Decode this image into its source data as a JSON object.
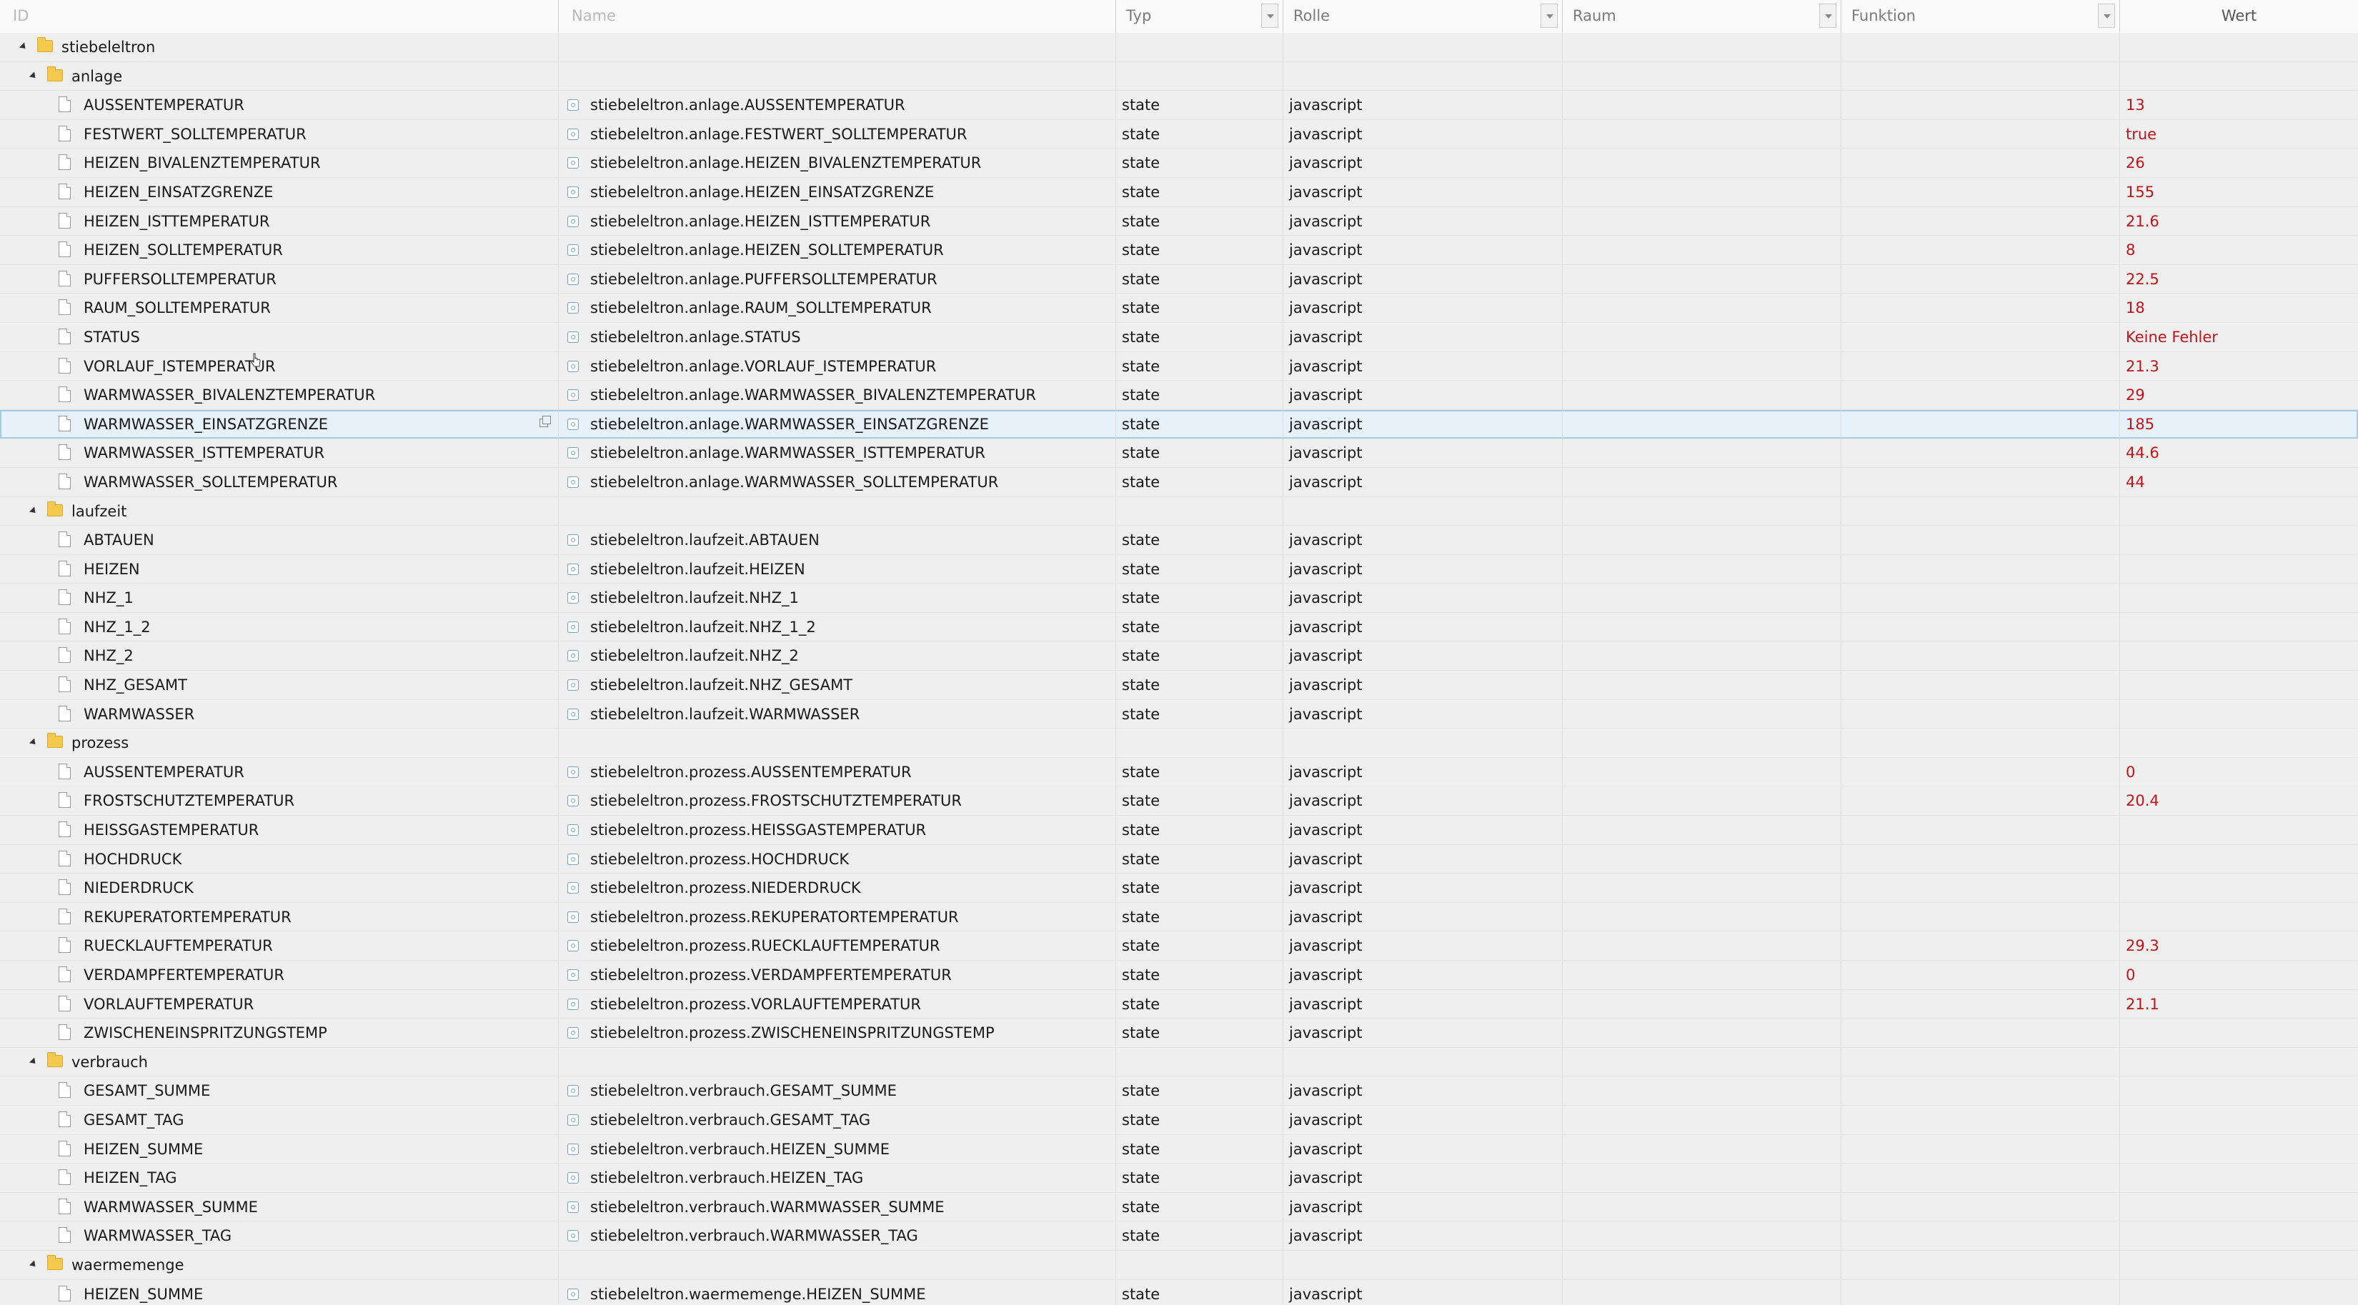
{
  "columns": {
    "id": "ID",
    "name": "Name",
    "typ": "Typ",
    "rolle": "Rolle",
    "raum": "Raum",
    "funktion": "Funktion",
    "wert": "Wert"
  },
  "rows": [
    {
      "kind": "folder",
      "level": 0,
      "label": "stiebeleltron"
    },
    {
      "kind": "folder",
      "level": 1,
      "label": "anlage"
    },
    {
      "kind": "state",
      "label": "AUSSENTEMPERATUR",
      "name": "stiebeleltron.anlage.AUSSENTEMPERATUR",
      "typ": "state",
      "rolle": "javascript",
      "wert": "13"
    },
    {
      "kind": "state",
      "label": "FESTWERT_SOLLTEMPERATUR",
      "name": "stiebeleltron.anlage.FESTWERT_SOLLTEMPERATUR",
      "typ": "state",
      "rolle": "javascript",
      "wert": "true"
    },
    {
      "kind": "state",
      "label": "HEIZEN_BIVALENZTEMPERATUR",
      "name": "stiebeleltron.anlage.HEIZEN_BIVALENZTEMPERATUR",
      "typ": "state",
      "rolle": "javascript",
      "wert": "26"
    },
    {
      "kind": "state",
      "label": "HEIZEN_EINSATZGRENZE",
      "name": "stiebeleltron.anlage.HEIZEN_EINSATZGRENZE",
      "typ": "state",
      "rolle": "javascript",
      "wert": "155"
    },
    {
      "kind": "state",
      "label": "HEIZEN_ISTTEMPERATUR",
      "name": "stiebeleltron.anlage.HEIZEN_ISTTEMPERATUR",
      "typ": "state",
      "rolle": "javascript",
      "wert": "21.6"
    },
    {
      "kind": "state",
      "label": "HEIZEN_SOLLTEMPERATUR",
      "name": "stiebeleltron.anlage.HEIZEN_SOLLTEMPERATUR",
      "typ": "state",
      "rolle": "javascript",
      "wert": "8"
    },
    {
      "kind": "state",
      "label": "PUFFERSOLLTEMPERATUR",
      "name": "stiebeleltron.anlage.PUFFERSOLLTEMPERATUR",
      "typ": "state",
      "rolle": "javascript",
      "wert": "22.5"
    },
    {
      "kind": "state",
      "label": "RAUM_SOLLTEMPERATUR",
      "name": "stiebeleltron.anlage.RAUM_SOLLTEMPERATUR",
      "typ": "state",
      "rolle": "javascript",
      "wert": "18"
    },
    {
      "kind": "state",
      "label": "STATUS",
      "name": "stiebeleltron.anlage.STATUS",
      "typ": "state",
      "rolle": "javascript",
      "wert": "Keine Fehler"
    },
    {
      "kind": "state",
      "label": "VORLAUF_ISTEMPERATUR",
      "name": "stiebeleltron.anlage.VORLAUF_ISTEMPERATUR",
      "typ": "state",
      "rolle": "javascript",
      "wert": "21.3"
    },
    {
      "kind": "state",
      "label": "WARMWASSER_BIVALENZTEMPERATUR",
      "name": "stiebeleltron.anlage.WARMWASSER_BIVALENZTEMPERATUR",
      "typ": "state",
      "rolle": "javascript",
      "wert": "29"
    },
    {
      "kind": "state",
      "label": "WARMWASSER_EINSATZGRENZE",
      "name": "stiebeleltron.anlage.WARMWASSER_EINSATZGRENZE",
      "typ": "state",
      "rolle": "javascript",
      "wert": "185",
      "selected": true
    },
    {
      "kind": "state",
      "label": "WARMWASSER_ISTTEMPERATUR",
      "name": "stiebeleltron.anlage.WARMWASSER_ISTTEMPERATUR",
      "typ": "state",
      "rolle": "javascript",
      "wert": "44.6"
    },
    {
      "kind": "state",
      "label": "WARMWASSER_SOLLTEMPERATUR",
      "name": "stiebeleltron.anlage.WARMWASSER_SOLLTEMPERATUR",
      "typ": "state",
      "rolle": "javascript",
      "wert": "44"
    },
    {
      "kind": "folder",
      "level": 1,
      "label": "laufzeit"
    },
    {
      "kind": "state",
      "label": "ABTAUEN",
      "name": "stiebeleltron.laufzeit.ABTAUEN",
      "typ": "state",
      "rolle": "javascript",
      "wert": ""
    },
    {
      "kind": "state",
      "label": "HEIZEN",
      "name": "stiebeleltron.laufzeit.HEIZEN",
      "typ": "state",
      "rolle": "javascript",
      "wert": ""
    },
    {
      "kind": "state",
      "label": "NHZ_1",
      "name": "stiebeleltron.laufzeit.NHZ_1",
      "typ": "state",
      "rolle": "javascript",
      "wert": ""
    },
    {
      "kind": "state",
      "label": "NHZ_1_2",
      "name": "stiebeleltron.laufzeit.NHZ_1_2",
      "typ": "state",
      "rolle": "javascript",
      "wert": ""
    },
    {
      "kind": "state",
      "label": "NHZ_2",
      "name": "stiebeleltron.laufzeit.NHZ_2",
      "typ": "state",
      "rolle": "javascript",
      "wert": ""
    },
    {
      "kind": "state",
      "label": "NHZ_GESAMT",
      "name": "stiebeleltron.laufzeit.NHZ_GESAMT",
      "typ": "state",
      "rolle": "javascript",
      "wert": ""
    },
    {
      "kind": "state",
      "label": "WARMWASSER",
      "name": "stiebeleltron.laufzeit.WARMWASSER",
      "typ": "state",
      "rolle": "javascript",
      "wert": ""
    },
    {
      "kind": "folder",
      "level": 1,
      "label": "prozess"
    },
    {
      "kind": "state",
      "label": "AUSSENTEMPERATUR",
      "name": "stiebeleltron.prozess.AUSSENTEMPERATUR",
      "typ": "state",
      "rolle": "javascript",
      "wert": "0"
    },
    {
      "kind": "state",
      "label": "FROSTSCHUTZTEMPERATUR",
      "name": "stiebeleltron.prozess.FROSTSCHUTZTEMPERATUR",
      "typ": "state",
      "rolle": "javascript",
      "wert": "20.4"
    },
    {
      "kind": "state",
      "label": "HEISSGASTEMPERATUR",
      "name": "stiebeleltron.prozess.HEISSGASTEMPERATUR",
      "typ": "state",
      "rolle": "javascript",
      "wert": ""
    },
    {
      "kind": "state",
      "label": "HOCHDRUCK",
      "name": "stiebeleltron.prozess.HOCHDRUCK",
      "typ": "state",
      "rolle": "javascript",
      "wert": ""
    },
    {
      "kind": "state",
      "label": "NIEDERDRUCK",
      "name": "stiebeleltron.prozess.NIEDERDRUCK",
      "typ": "state",
      "rolle": "javascript",
      "wert": ""
    },
    {
      "kind": "state",
      "label": "REKUPERATORTEMPERATUR",
      "name": "stiebeleltron.prozess.REKUPERATORTEMPERATUR",
      "typ": "state",
      "rolle": "javascript",
      "wert": ""
    },
    {
      "kind": "state",
      "label": "RUECKLAUFTEMPERATUR",
      "name": "stiebeleltron.prozess.RUECKLAUFTEMPERATUR",
      "typ": "state",
      "rolle": "javascript",
      "wert": "29.3"
    },
    {
      "kind": "state",
      "label": "VERDAMPFERTEMPERATUR",
      "name": "stiebeleltron.prozess.VERDAMPFERTEMPERATUR",
      "typ": "state",
      "rolle": "javascript",
      "wert": "0"
    },
    {
      "kind": "state",
      "label": "VORLAUFTEMPERATUR",
      "name": "stiebeleltron.prozess.VORLAUFTEMPERATUR",
      "typ": "state",
      "rolle": "javascript",
      "wert": "21.1"
    },
    {
      "kind": "state",
      "label": "ZWISCHENEINSPRITZUNGSTEMP",
      "name": "stiebeleltron.prozess.ZWISCHENEINSPRITZUNGSTEMP",
      "typ": "state",
      "rolle": "javascript",
      "wert": ""
    },
    {
      "kind": "folder",
      "level": 1,
      "label": "verbrauch"
    },
    {
      "kind": "state",
      "label": "GESAMT_SUMME",
      "name": "stiebeleltron.verbrauch.GESAMT_SUMME",
      "typ": "state",
      "rolle": "javascript",
      "wert": ""
    },
    {
      "kind": "state",
      "label": "GESAMT_TAG",
      "name": "stiebeleltron.verbrauch.GESAMT_TAG",
      "typ": "state",
      "rolle": "javascript",
      "wert": ""
    },
    {
      "kind": "state",
      "label": "HEIZEN_SUMME",
      "name": "stiebeleltron.verbrauch.HEIZEN_SUMME",
      "typ": "state",
      "rolle": "javascript",
      "wert": ""
    },
    {
      "kind": "state",
      "label": "HEIZEN_TAG",
      "name": "stiebeleltron.verbrauch.HEIZEN_TAG",
      "typ": "state",
      "rolle": "javascript",
      "wert": ""
    },
    {
      "kind": "state",
      "label": "WARMWASSER_SUMME",
      "name": "stiebeleltron.verbrauch.WARMWASSER_SUMME",
      "typ": "state",
      "rolle": "javascript",
      "wert": ""
    },
    {
      "kind": "state",
      "label": "WARMWASSER_TAG",
      "name": "stiebeleltron.verbrauch.WARMWASSER_TAG",
      "typ": "state",
      "rolle": "javascript",
      "wert": ""
    },
    {
      "kind": "folder",
      "level": 1,
      "label": "waermemenge"
    },
    {
      "kind": "state",
      "label": "HEIZEN_SUMME",
      "name": "stiebeleltron.waermemenge.HEIZEN_SUMME",
      "typ": "state",
      "rolle": "javascript",
      "wert": ""
    }
  ],
  "colors": {
    "value": "#c0141a",
    "selected_row": "#e6f1fa",
    "folder": "#f3c94e"
  },
  "icons": {
    "folder": "folder-icon",
    "state": "file-icon",
    "object": "state-object-icon",
    "expand": "expand-arrow-icon",
    "copy": "copy-icon"
  }
}
